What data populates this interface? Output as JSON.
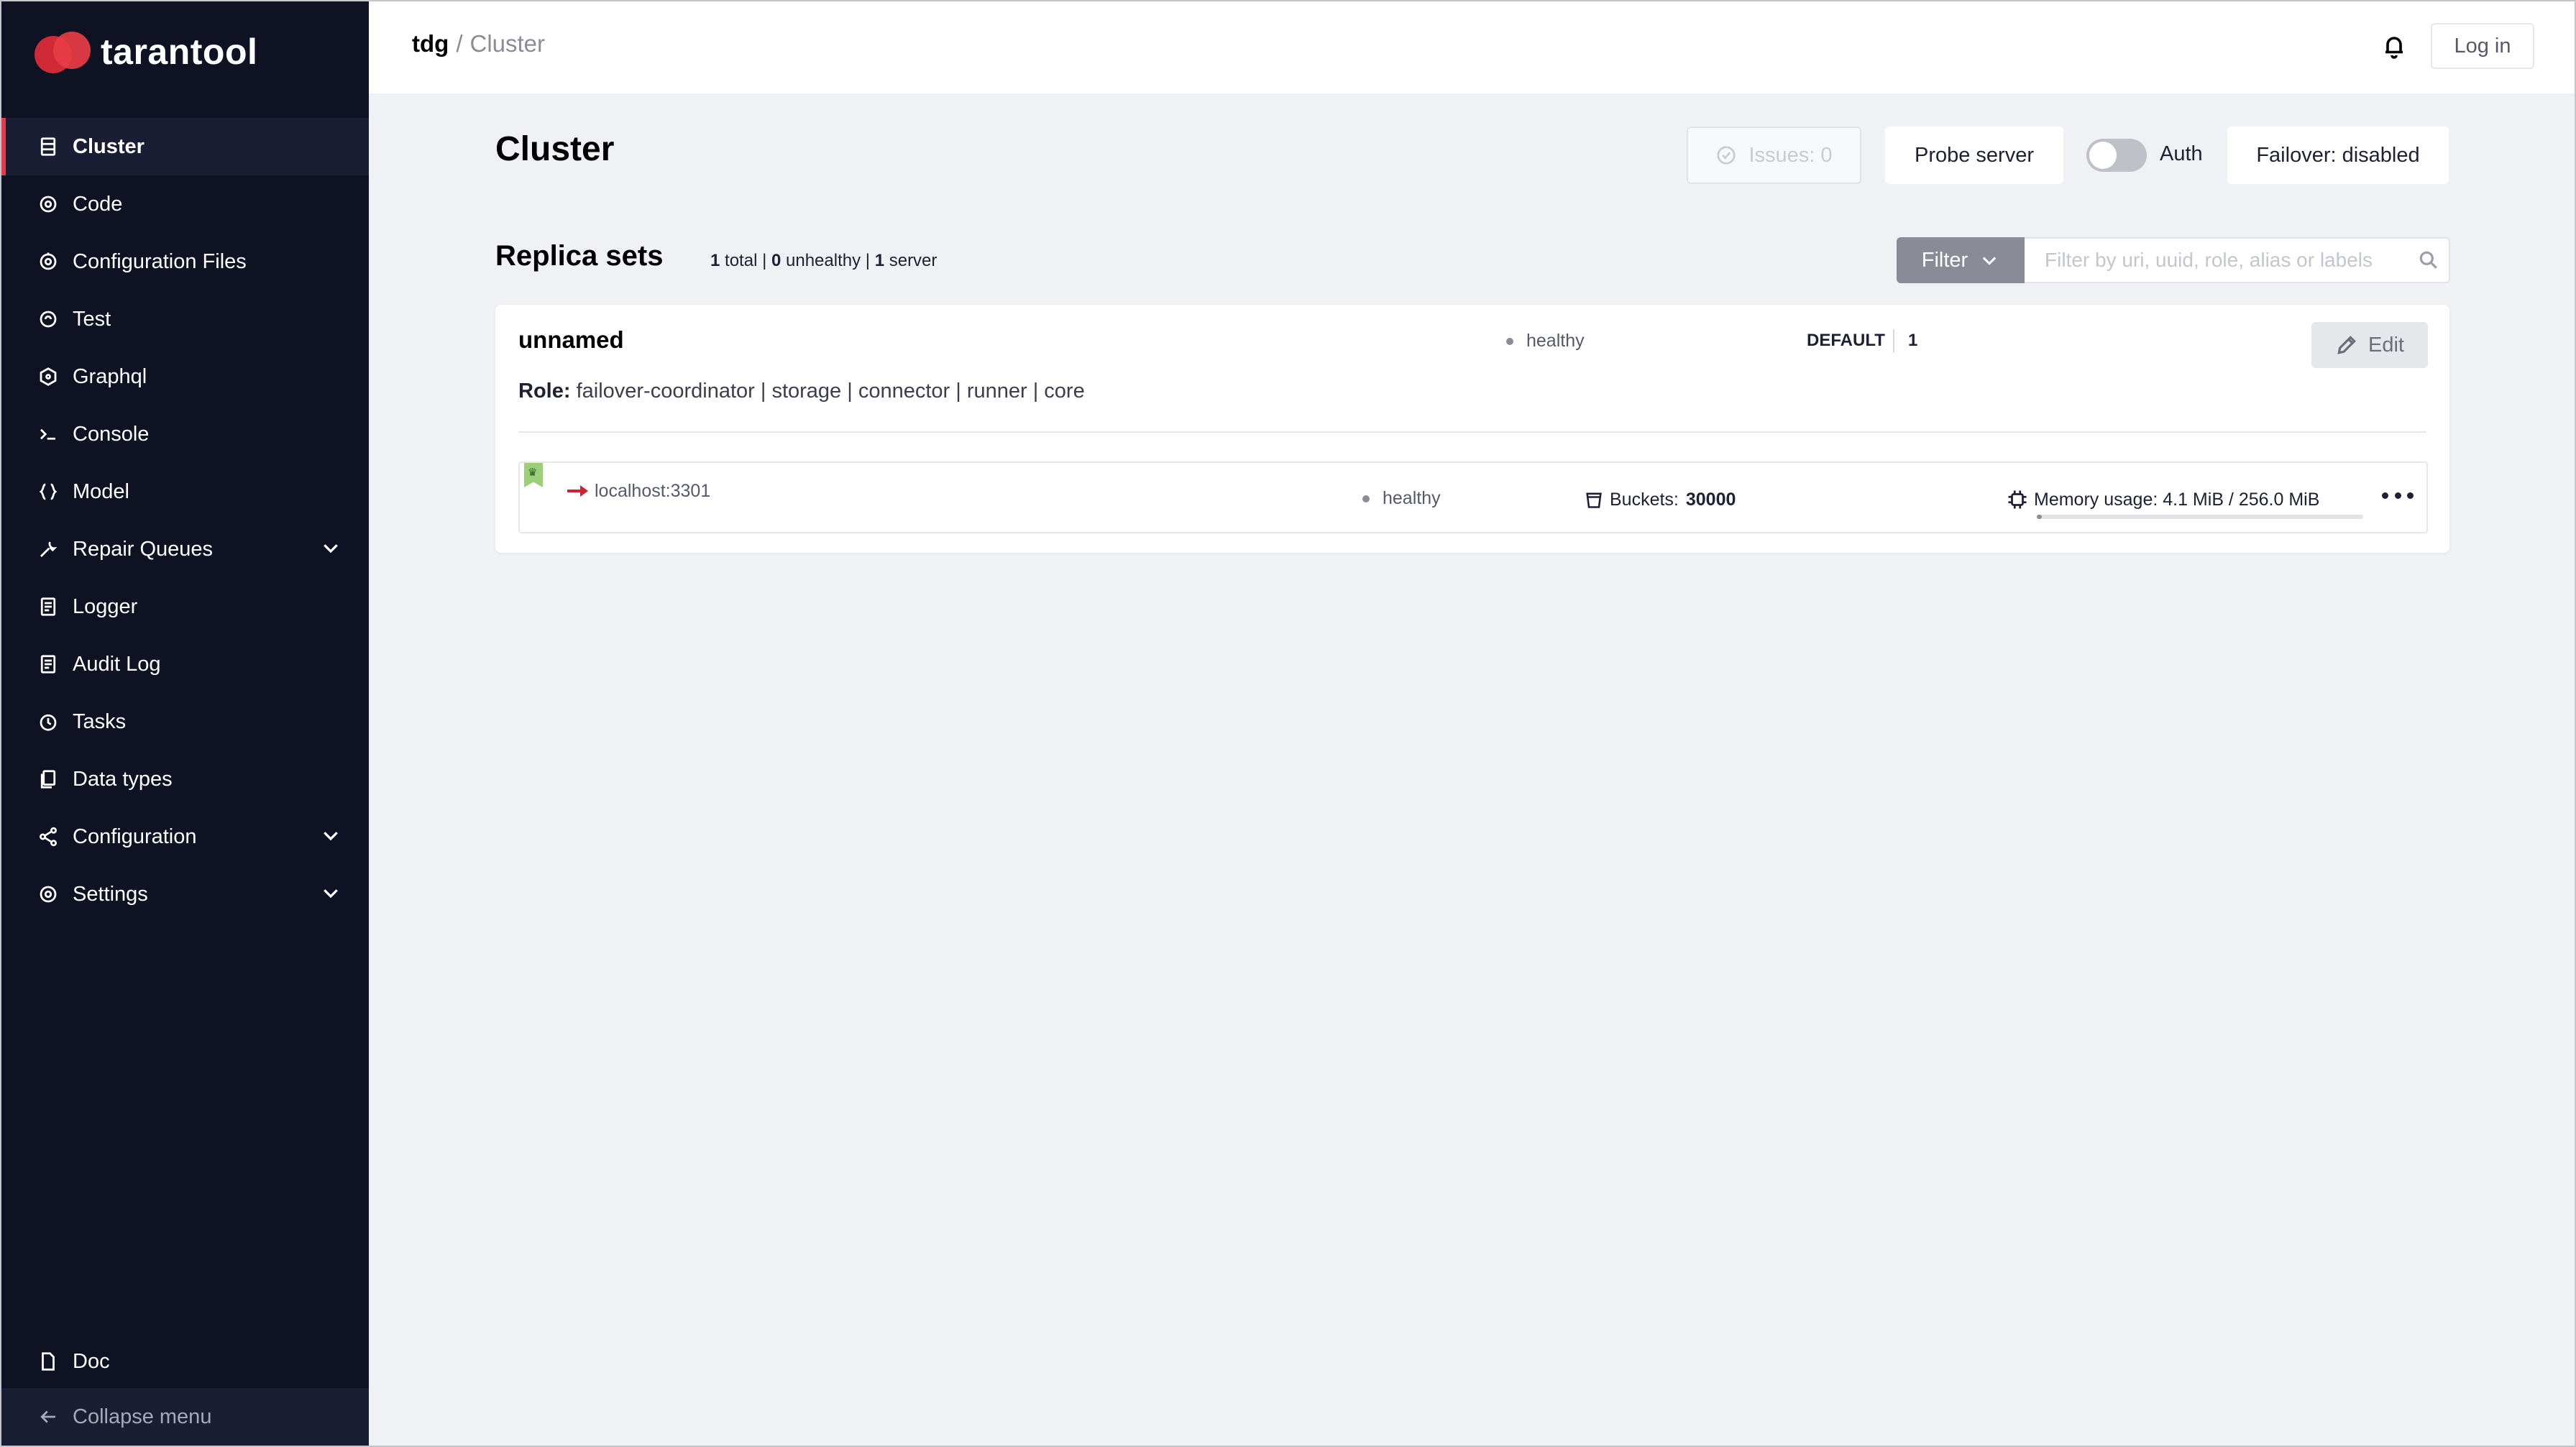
{
  "app": {
    "brand": "tarantool",
    "brand_color": "#e33c49"
  },
  "sidebar": {
    "items": [
      {
        "label": "Cluster",
        "icon": "cluster-icon",
        "active": true
      },
      {
        "label": "Code",
        "icon": "code-icon"
      },
      {
        "label": "Configuration Files",
        "icon": "config-files-icon"
      },
      {
        "label": "Test",
        "icon": "test-icon"
      },
      {
        "label": "Graphql",
        "icon": "graphql-icon"
      },
      {
        "label": "Console",
        "icon": "console-icon"
      },
      {
        "label": "Model",
        "icon": "model-icon"
      },
      {
        "label": "Repair Queues",
        "icon": "repair-queues-icon",
        "expandable": true
      },
      {
        "label": "Logger",
        "icon": "logger-icon"
      },
      {
        "label": "Audit Log",
        "icon": "audit-log-icon"
      },
      {
        "label": "Tasks",
        "icon": "tasks-icon"
      },
      {
        "label": "Data types",
        "icon": "data-types-icon"
      },
      {
        "label": "Configuration",
        "icon": "configuration-icon",
        "expandable": true
      },
      {
        "label": "Settings",
        "icon": "settings-icon",
        "expandable": true
      }
    ],
    "doc_label": "Doc",
    "collapse_label": "Collapse menu"
  },
  "header": {
    "breadcrumb_app": "tdg",
    "breadcrumb_separator": "/",
    "breadcrumb_page": "Cluster",
    "login_label": "Log in"
  },
  "main": {
    "title": "Cluster",
    "issues_label": "Issues: 0",
    "probe_label": "Probe server",
    "auth_label": "Auth",
    "auth_enabled": false,
    "failover_label": "Failover: disabled",
    "section_title": "Replica sets",
    "stats": {
      "total_count": "1",
      "total_label": "total",
      "unhealthy_count": "0",
      "unhealthy_label": "unhealthy",
      "server_count": "1",
      "server_label": "server"
    },
    "filter_label": "Filter",
    "search_placeholder": "Filter by uri, uuid, role, alias or labels"
  },
  "replica_set": {
    "name": "unnamed",
    "status": "healthy",
    "group": "DEFAULT",
    "weight": "1",
    "edit_label": "Edit",
    "roles_label": "Role:",
    "roles": "failover-coordinator | storage | connector | runner | core",
    "server": {
      "uri": "localhost:3301",
      "status": "healthy",
      "buckets_label": "Buckets:",
      "buckets_value": "30000",
      "memory_label": "Memory usage: 4.1 MiB / 256.0 MiB",
      "memory_fraction": 0.016
    }
  }
}
